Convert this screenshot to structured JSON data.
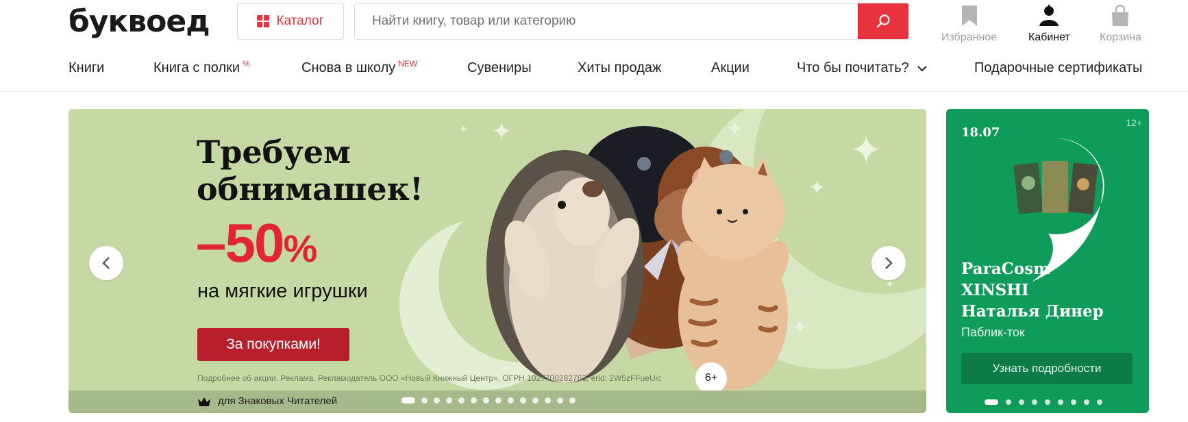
{
  "header": {
    "logo": "буквоед",
    "catalog_label": "Каталог",
    "search_placeholder": "Найти книгу, товар или категорию",
    "actions": {
      "favorites": "Избранное",
      "cabinet": "Кабинет",
      "cart": "Корзина"
    }
  },
  "nav": {
    "items": [
      {
        "label": "Книги",
        "sup": ""
      },
      {
        "label": "Книга с полки",
        "sup": "%"
      },
      {
        "label": "Снова в школу",
        "sup": "NEW"
      },
      {
        "label": "Сувениры",
        "sup": ""
      },
      {
        "label": "Хиты продаж",
        "sup": ""
      },
      {
        "label": "Акции",
        "sup": ""
      },
      {
        "label": "Что бы почитать?",
        "sup": ""
      },
      {
        "label": "Подарочные сертификаты",
        "sup": ""
      }
    ]
  },
  "banner": {
    "title_line1": "Требуем",
    "title_line2": "обнимашек!",
    "discount_value": "–50",
    "discount_unit": "%",
    "subtitle": "на мягкие игрушки",
    "button_label": "За покупками!",
    "legal": "Подробнее об акции. Реклама. Рекламодатель ООО «Новый Книжный Центр», ОГРН 1027700282763, erid: 2W5zFFueUic",
    "age": "6+",
    "footer_label": "для Знаковых Читателей",
    "slides_total": 14,
    "active_slide": 1
  },
  "side": {
    "date": "18.07",
    "age": "12+",
    "line1": "ParaCosm",
    "line2": "XINSHI",
    "line3": "Наталья Динер",
    "subtitle": "Паблик-ток",
    "button_label": "Узнать подробности",
    "slides_total": 9,
    "active_slide": 1
  },
  "colors": {
    "brand_red": "#e8323f",
    "banner_bg": "#c6d9a4",
    "side_bg": "#0f9c5b"
  }
}
